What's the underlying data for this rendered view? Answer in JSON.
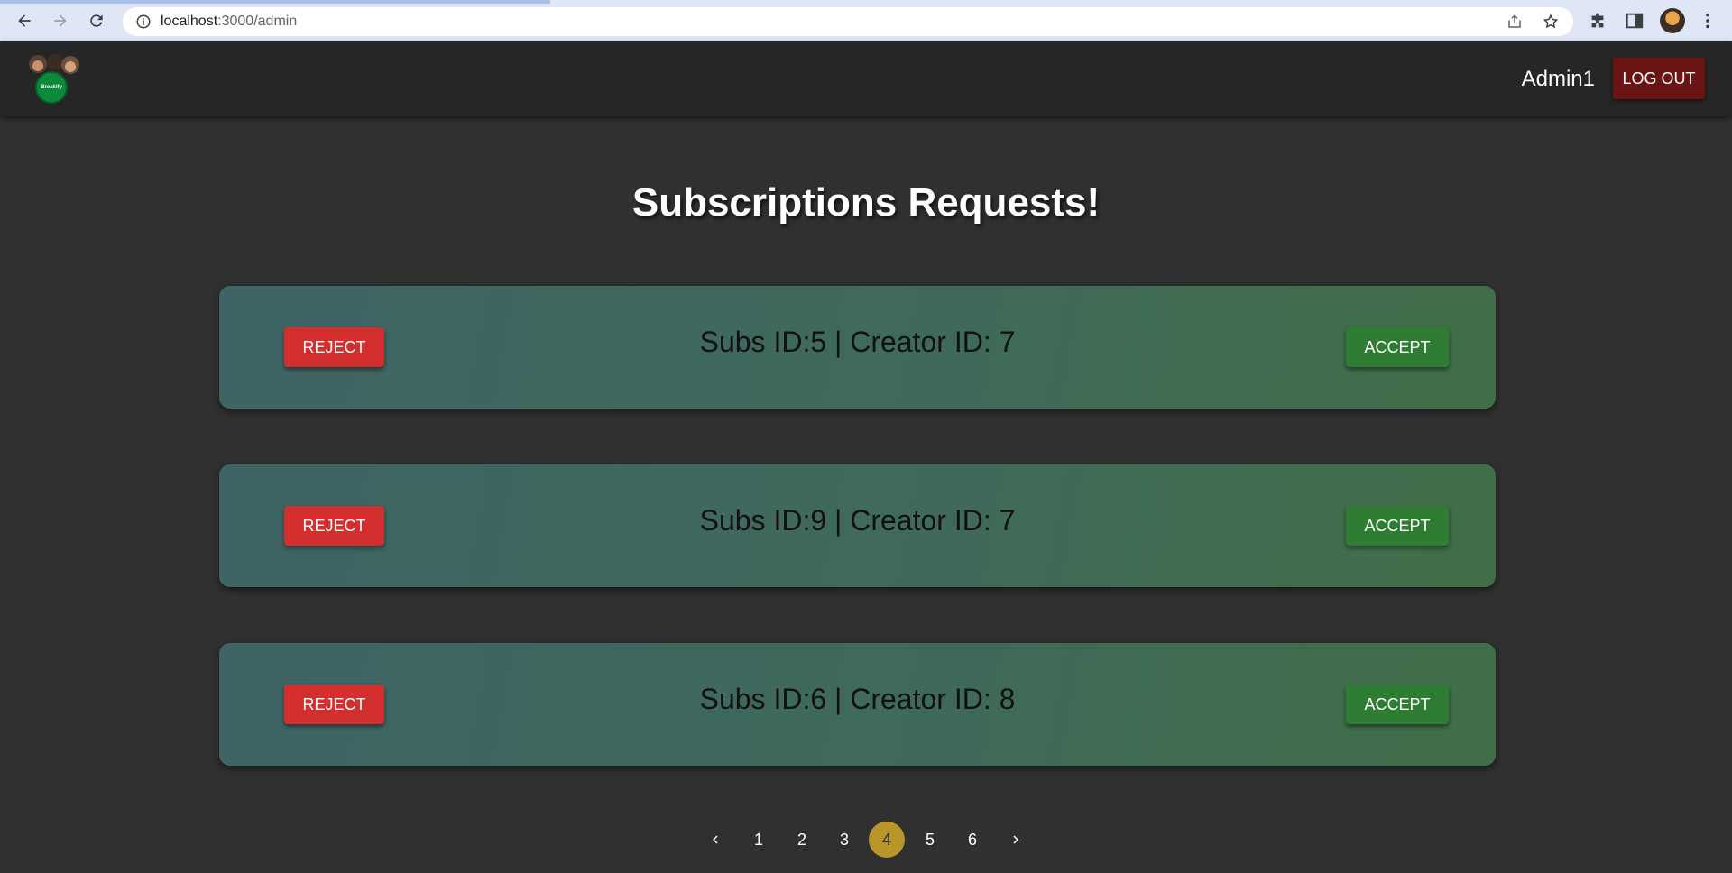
{
  "browser": {
    "url_host": "localhost",
    "url_path": ":3000/admin"
  },
  "header": {
    "logo_text": "Breakify",
    "admin_name": "Admin1",
    "logout_label": "LOG OUT"
  },
  "main": {
    "title": "Subscriptions Requests!",
    "requests": [
      {
        "text": "Subs ID:5 | Creator ID: 7",
        "reject_label": "REJECT",
        "accept_label": "ACCEPT"
      },
      {
        "text": "Subs ID:9 | Creator ID: 7",
        "reject_label": "REJECT",
        "accept_label": "ACCEPT"
      },
      {
        "text": "Subs ID:6 | Creator ID: 8",
        "reject_label": "REJECT",
        "accept_label": "ACCEPT"
      }
    ]
  },
  "pagination": {
    "pages": [
      "1",
      "2",
      "3",
      "4",
      "5",
      "6"
    ],
    "current": "4"
  },
  "colors": {
    "reject": "#d32f2f",
    "accept": "#2e7d32",
    "logout": "#6b1414",
    "active_page": "#b8962a",
    "background": "#303030"
  }
}
